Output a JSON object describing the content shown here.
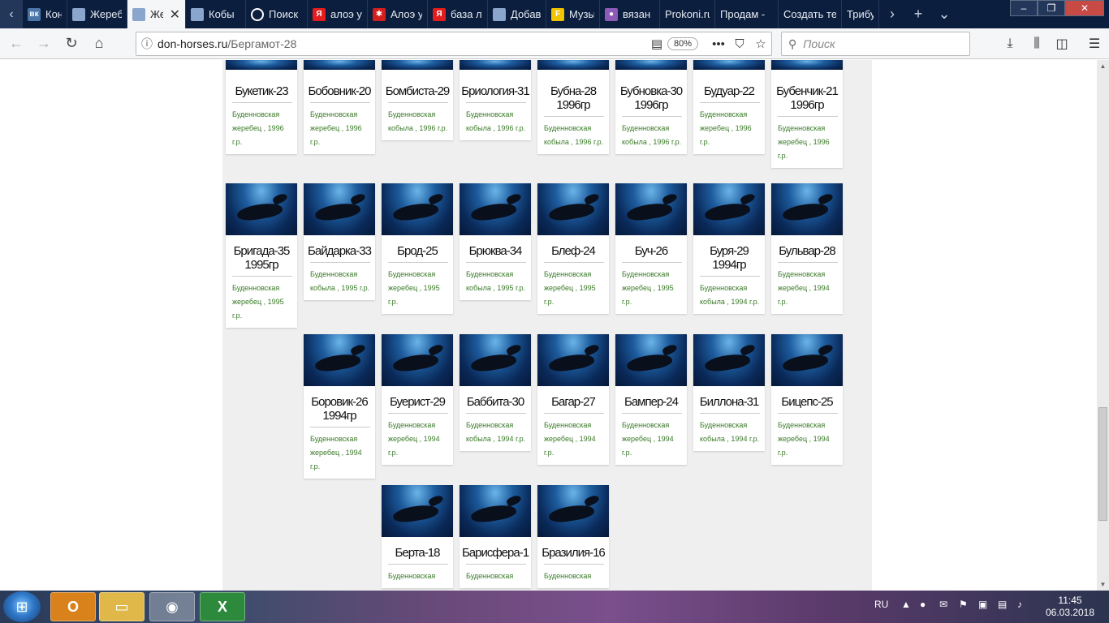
{
  "tabs": [
    {
      "title": "Коноб",
      "icon": "vk-icon",
      "color": "#4a76a8",
      "glyph": "вк"
    },
    {
      "title": "Жереб",
      "icon": "page-icon",
      "color": "#8aa6cc",
      "glyph": ""
    },
    {
      "title": "Же",
      "icon": "page-icon",
      "color": "#8aa6cc",
      "glyph": "",
      "active": true
    },
    {
      "title": "Кобы",
      "icon": "page-icon",
      "color": "#8aa6cc",
      "glyph": ""
    },
    {
      "title": "Поиск",
      "icon": "search-engine-icon",
      "color": "#ffffff",
      "glyph": ""
    },
    {
      "title": "алоэ у",
      "icon": "yandex-icon",
      "color": "#e31d1d",
      "glyph": "Я"
    },
    {
      "title": "Алоэ у",
      "icon": "flower-icon",
      "color": "#d41f1f",
      "glyph": "✱"
    },
    {
      "title": "база л",
      "icon": "yandex-icon",
      "color": "#e31d1d",
      "glyph": "Я"
    },
    {
      "title": "Добав",
      "icon": "page-icon",
      "color": "#8aa6cc",
      "glyph": ""
    },
    {
      "title": "Музы",
      "icon": "f-icon",
      "color": "#f2c300",
      "glyph": "F"
    },
    {
      "title": "вязан",
      "icon": "dots-icon",
      "color": "#8e5ab8",
      "glyph": "●"
    },
    {
      "title": "Prokoni.ru",
      "icon": "",
      "color": "",
      "glyph": ""
    },
    {
      "title": "Продам -",
      "icon": "",
      "color": "",
      "glyph": ""
    },
    {
      "title": "Создать те",
      "icon": "",
      "color": "",
      "glyph": ""
    },
    {
      "title": "Трибу",
      "icon": "",
      "color": "",
      "glyph": ""
    }
  ],
  "navbar": {
    "url_domain": "don-horses.ru",
    "url_path": "/Бергамот-28",
    "zoom": "80%",
    "search_placeholder": "Поиск"
  },
  "cards": [
    {
      "name": "Букетик-23",
      "name2": "",
      "desc": "Буденновская жеребец , 1996 г.р."
    },
    {
      "name": "Бобовник-20",
      "name2": "",
      "desc": "Буденновская жеребец , 1996 г.р."
    },
    {
      "name": "Бомбиста-29",
      "name2": "",
      "desc": "Буденновская кобыла , 1996 г.р."
    },
    {
      "name": "Бриология-31",
      "name2": "",
      "desc": "Буденновская кобыла , 1996 г.р."
    },
    {
      "name": "Бубна-28",
      "name2": "1996гр",
      "desc": "Буденновская кобыла , 1996 г.р."
    },
    {
      "name": "Бубновка-30",
      "name2": "1996гр",
      "desc": "Буденновская кобыла , 1996 г.р."
    },
    {
      "name": "Будуар-22",
      "name2": "",
      "desc": "Буденновская жеребец , 1996 г.р."
    },
    {
      "name": "Бубенчик-21",
      "name2": "1996гр",
      "desc": "Буденновская жеребец , 1996 г.р."
    },
    {
      "name": "Бригада-35",
      "name2": "1995гр",
      "desc": "Буденновская жеребец , 1995 г.р."
    },
    {
      "name": "Байдарка-33",
      "name2": "",
      "desc": "Буденновская кобыла , 1995 г.р."
    },
    {
      "name": "Брод-25",
      "name2": "",
      "desc": "Буденновская жеребец , 1995 г.р."
    },
    {
      "name": "Брюква-34",
      "name2": "",
      "desc": "Буденновская кобыла , 1995 г.р."
    },
    {
      "name": "Блеф-24",
      "name2": "",
      "desc": "Буденновская жеребец , 1995 г.р."
    },
    {
      "name": "Буч-26",
      "name2": "",
      "desc": "Буденновская жеребец , 1995 г.р."
    },
    {
      "name": "Буря-29",
      "name2": "1994гр",
      "desc": "Буденновская кобыла , 1994 г.р."
    },
    {
      "name": "Бульвар-28",
      "name2": "",
      "desc": "Буденновская жеребец , 1994 г.р."
    },
    {
      "name": "Боровик-26",
      "name2": "1994гр",
      "desc": "Буденновская жеребец , 1994 г.р."
    },
    {
      "name": "Буерист-29",
      "name2": "",
      "desc": "Буденновская жеребец , 1994 г.р."
    },
    {
      "name": "Баббита-30",
      "name2": "",
      "desc": "Буденновская кобыла , 1994 г.р."
    },
    {
      "name": "Багар-27",
      "name2": "",
      "desc": "Буденновская жеребец , 1994 г.р."
    },
    {
      "name": "Бампер-24",
      "name2": "",
      "desc": "Буденновская жеребец , 1994 г.р."
    },
    {
      "name": "Биллона-31",
      "name2": "",
      "desc": "Буденновская кобыла , 1994 г.р."
    },
    {
      "name": "Бицепс-25",
      "name2": "",
      "desc": "Буденновская жеребец , 1994 г.р."
    },
    {
      "name": "Берта-18",
      "name2": "",
      "desc": "Буденновская"
    },
    {
      "name": "Барисфера-1",
      "name2": "",
      "desc": "Буденновская"
    },
    {
      "name": "Бразилия-16",
      "name2": "",
      "desc": "Буденновская"
    }
  ],
  "taskbar": {
    "lang": "RU",
    "time": "11:45",
    "date": "06.03.2018"
  }
}
